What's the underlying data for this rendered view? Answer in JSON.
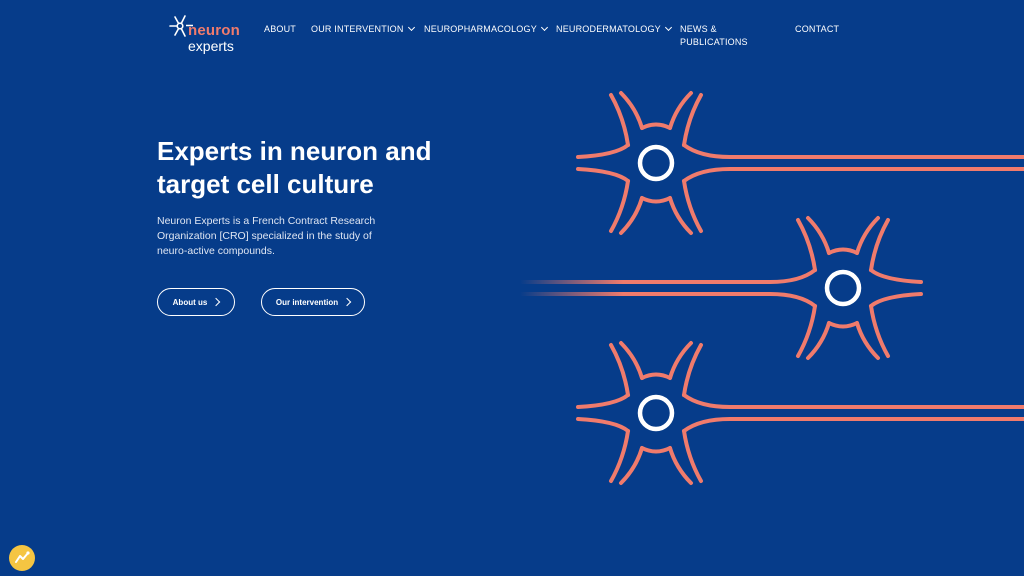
{
  "logo": {
    "word1": "neuron",
    "word2": "experts"
  },
  "nav": {
    "about": "ABOUT",
    "intervention": "OUR INTERVENTION",
    "neuropharmacology": "NEUROPHARMACOLOGY",
    "neurodermatology": "NEURODERMATOLOGY",
    "news": "NEWS & PUBLICATIONS",
    "contact": "CONTACT"
  },
  "hero": {
    "title": "Experts in neuron and target cell culture",
    "description": "Neuron Experts is a French Contract Research Organization [CRO] specialized in the study of neuro-active compounds.",
    "btn_about": "About us",
    "btn_intervention": "Our intervention"
  },
  "colors": {
    "background": "#063c8a",
    "neuron_stroke": "#f07b6c",
    "nucleus": "#ffffff",
    "cookie_badge": "#f5c542"
  },
  "icons": [
    "neuron-logo-icon",
    "chevron-down-icon",
    "chevron-right-icon",
    "neuron-illustration",
    "cookie-icon"
  ]
}
